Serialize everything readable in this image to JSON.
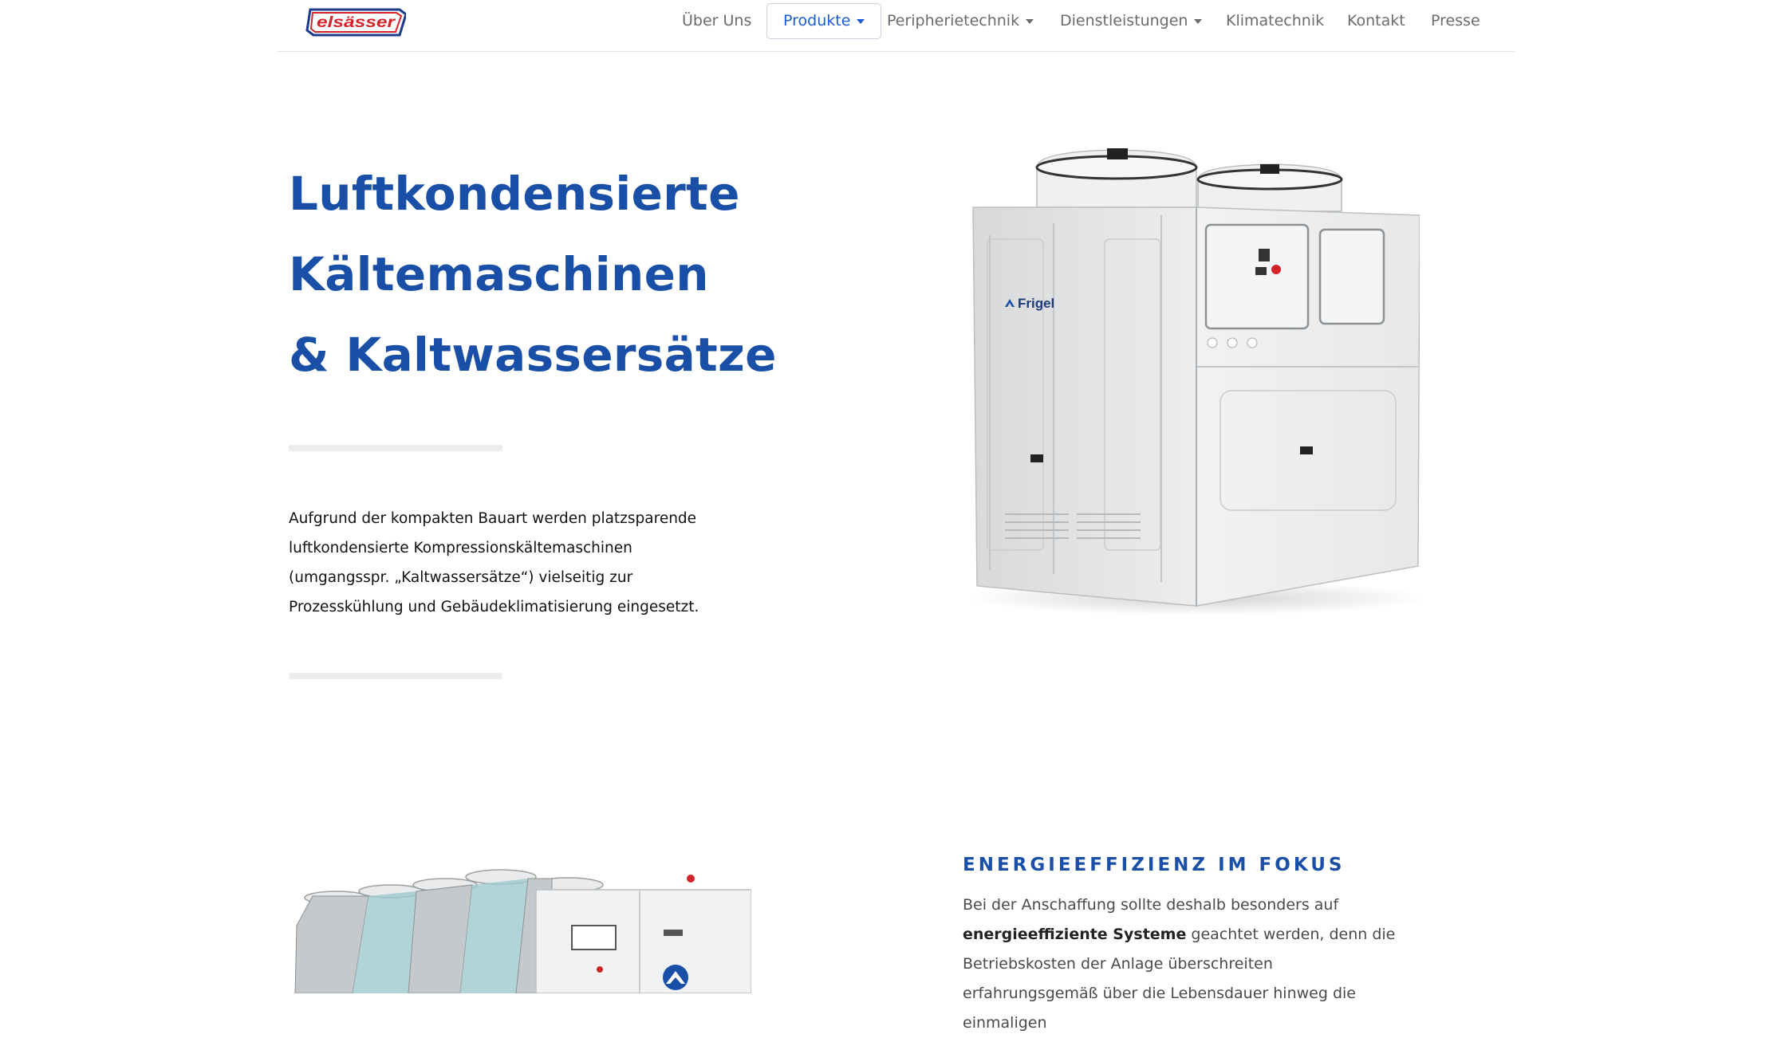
{
  "header": {
    "logo_text": "elsässer",
    "nav": [
      {
        "label": "Über Uns"
      },
      {
        "label": "Produkte"
      },
      {
        "label": "Peripherietechnik"
      },
      {
        "label": "Dienstleistungen"
      },
      {
        "label": "Klimatechnik"
      },
      {
        "label": "Kontakt"
      },
      {
        "label": "Presse"
      }
    ]
  },
  "hero": {
    "title_lines": [
      "Luftkondensierte",
      "Kältemaschinen",
      "& Kaltwassersätze"
    ],
    "description": "Aufgrund der kompakten Bauart werden platzsparende luftkondensierte Kompressionskältemaschinen (umgangsspr. „Kaltwassersätze“) vielseitig zur Prozesskühlung und Gebäudeklimatisierung eingesetzt.",
    "image_brand": "Frigel"
  },
  "section2": {
    "heading": "ENERGIEEFFIZIENZ IM FOKUS",
    "text_before": "Bei der Anschaffung sollte deshalb besonders auf ",
    "text_bold": "energieeffiziente Systeme",
    "text_after": " geachtet werden, denn die Betriebskosten der Anlage überschreiten erfahrungsgemäß über die Lebensdauer hinweg die einmaligen"
  },
  "colors": {
    "brand_blue": "#1a4fa8",
    "nav_active": "#1a5cd6",
    "logo_red": "#d2232a"
  }
}
